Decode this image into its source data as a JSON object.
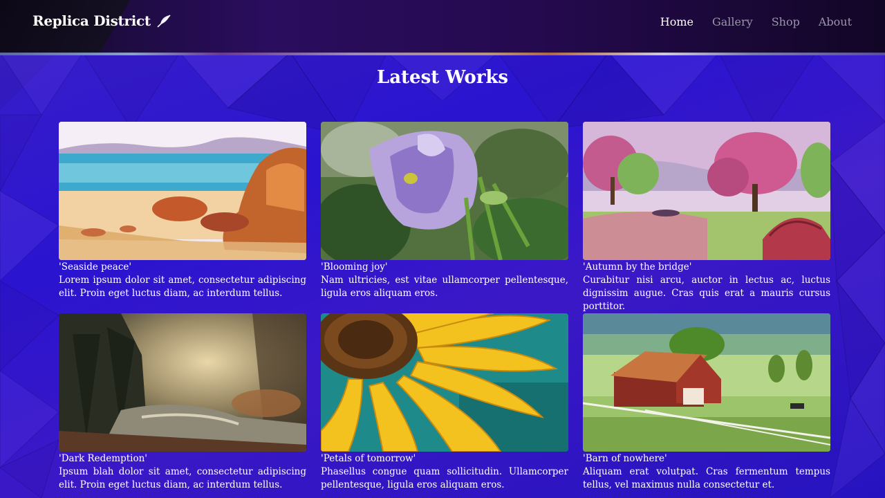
{
  "brand": {
    "name": "Replica District",
    "icon": "feather-icon"
  },
  "nav": [
    {
      "label": "Home",
      "active": true
    },
    {
      "label": "Gallery",
      "active": false
    },
    {
      "label": "Shop",
      "active": false
    },
    {
      "label": "About",
      "active": false
    }
  ],
  "section": {
    "heading": "Latest Works"
  },
  "works": [
    {
      "title": "'Seaside peace'",
      "description": "Lorem ipsum dolor sit amet, consectetur adipiscing elit. Proin eget luctus diam, ac interdum tellus."
    },
    {
      "title": "'Blooming joy'",
      "description": "Nam ultricies, est vitae ullamcorper pellentesque, ligula eros aliquam eros."
    },
    {
      "title": "'Autumn by the bridge'",
      "description": "Curabitur nisi arcu, auctor in lectus ac, luctus dignissim augue. Cras quis erat a mauris cursus porttitor."
    },
    {
      "title": "'Dark Redemption'",
      "description": "Ipsum blah dolor sit amet, consectetur adipiscing elit. Proin eget luctus diam, ac interdum tellus."
    },
    {
      "title": "'Petals of tomorrow'",
      "description": "Phasellus congue quam sollicitudin. Ullamcorper pellentesque, ligula eros aliquam eros."
    },
    {
      "title": "'Barn of nowhere'",
      "description": "Aliquam erat volutpat. Cras fermentum tempus tellus, vel maximus nulla consectetur et."
    }
  ]
}
